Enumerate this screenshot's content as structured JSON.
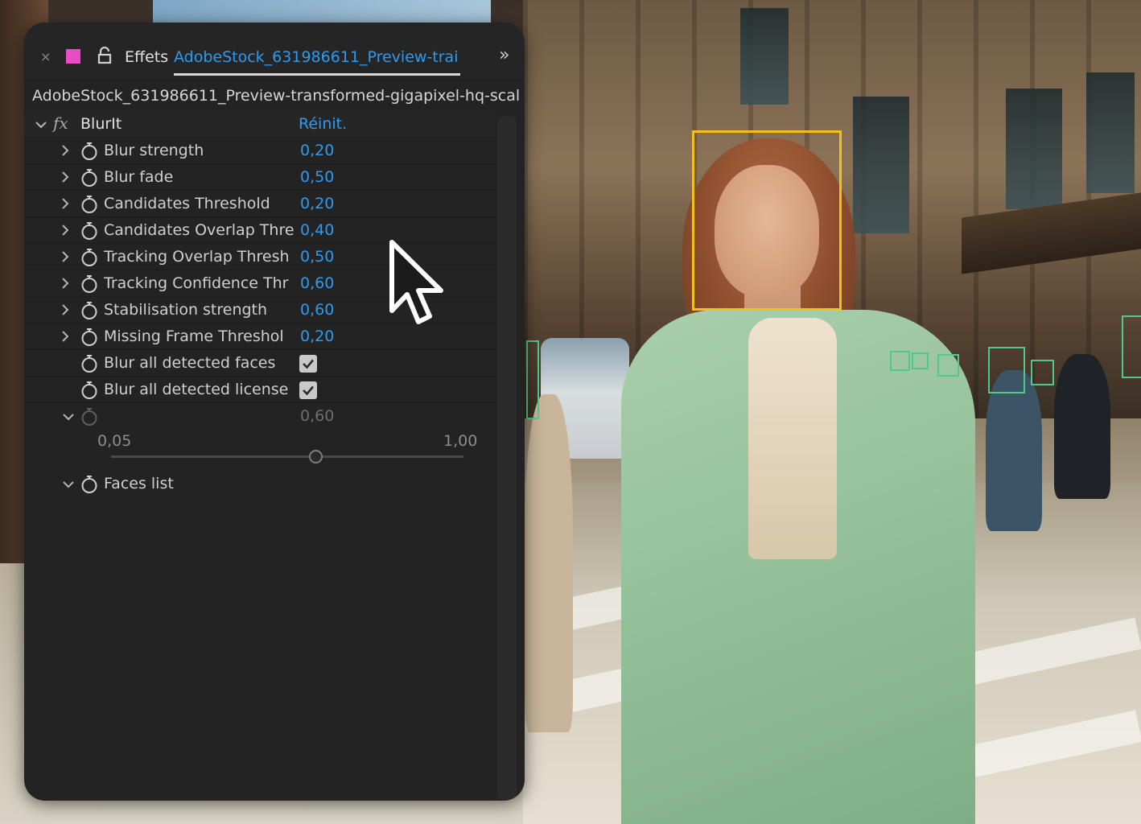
{
  "panel": {
    "close_glyph": "×",
    "label_color": "#ec4bc6",
    "lock_icon": "lock-icon",
    "title": "Effets",
    "file_tab": "AdobeStock_631986611_Preview-trai",
    "more_glyph": "»",
    "layer_path": "AdobeStock_631986611_Preview-transformed-gigapixel-hq-scal"
  },
  "effect": {
    "name": "BlurIt",
    "reset_label": "Réinit.",
    "params": [
      {
        "label": "Blur strength",
        "value": "0,20"
      },
      {
        "label": "Blur fade",
        "value": "0,50"
      },
      {
        "label": "Candidates Threshold",
        "value": "0,20"
      },
      {
        "label": "Candidates Overlap Thre",
        "value": "0,40"
      },
      {
        "label": "Tracking Overlap Thresh",
        "value": "0,50"
      },
      {
        "label": "Tracking Confidence Thr",
        "value": "0,60"
      },
      {
        "label": "Stabilisation strength",
        "value": "0,60"
      },
      {
        "label": "Missing Frame Threshol",
        "value": "0,20"
      }
    ],
    "checkboxes": [
      {
        "label": "Blur all detected faces",
        "checked": true
      },
      {
        "label": "Blur all detected license",
        "checked": true
      }
    ],
    "expanded_param": {
      "value": "0,60",
      "slider_min": "0,05",
      "slider_max": "1,00",
      "fraction": 0.579
    },
    "faces_list_label": "Faces list"
  },
  "colors": {
    "accent": "#2e9bf0",
    "panel_bg": "#232323",
    "face_box": "#f3c11d",
    "detect_box": "#52c98c"
  }
}
